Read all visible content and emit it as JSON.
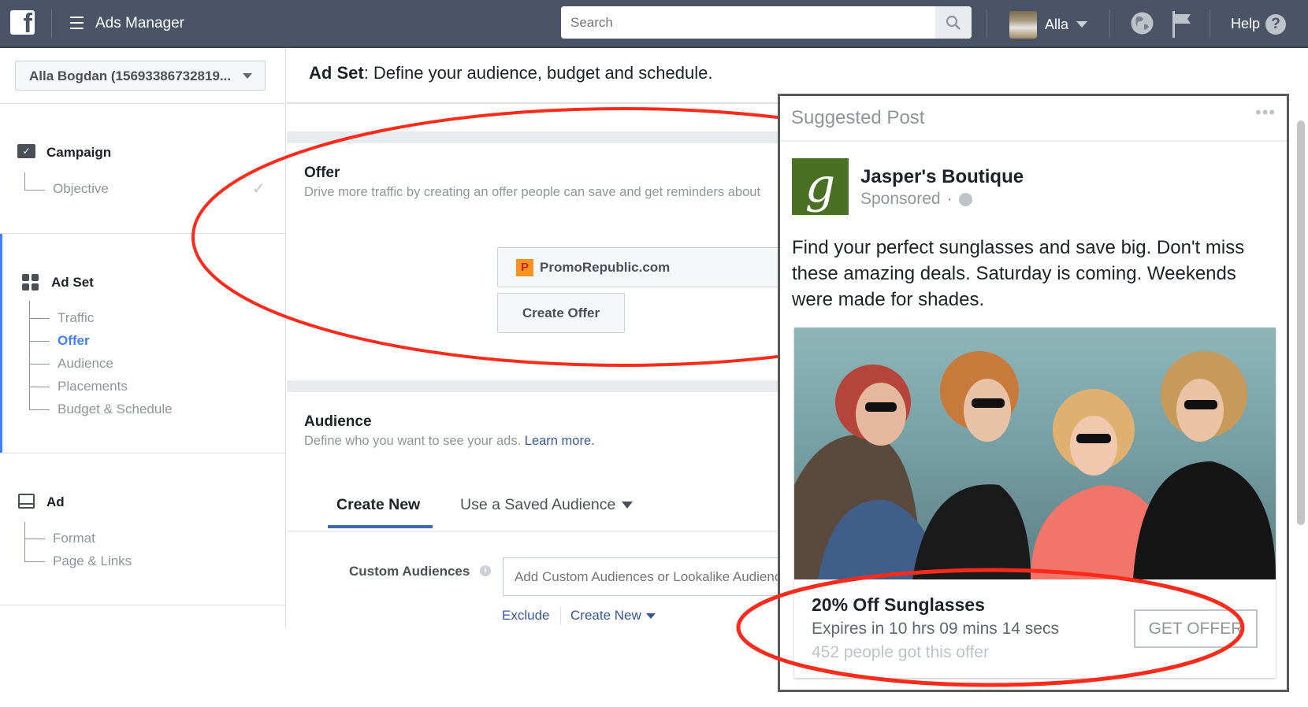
{
  "topbar": {
    "app_title": "Ads Manager",
    "search_placeholder": "Search",
    "user_name": "Alla",
    "help_label": "Help"
  },
  "sidebar": {
    "account": "Alla Bogdan (15693386732819...",
    "sections": [
      {
        "label": "Campaign",
        "items": [
          {
            "label": "Objective",
            "completed": true
          }
        ]
      },
      {
        "label": "Ad Set",
        "items": [
          {
            "label": "Traffic"
          },
          {
            "label": "Offer",
            "active": true
          },
          {
            "label": "Audience"
          },
          {
            "label": "Placements"
          },
          {
            "label": "Budget & Schedule"
          }
        ]
      },
      {
        "label": "Ad",
        "items": [
          {
            "label": "Format"
          },
          {
            "label": "Page & Links"
          }
        ]
      }
    ]
  },
  "main": {
    "header_bold": "Ad Set",
    "header_rest": ": Define your audience, budget and schedule.",
    "offer": {
      "title": "Offer",
      "description": "Drive more traffic by creating an offer people can save and get reminders about",
      "page_name": "PromoRepublic.com",
      "create_button": "Create Offer"
    },
    "audience": {
      "title": "Audience",
      "description": "Define who you want to see your ads.",
      "learn_more": "Learn more.",
      "tabs": [
        {
          "label": "Create New",
          "active": true
        },
        {
          "label": "Use a Saved Audience"
        }
      ],
      "custom_label": "Custom Audiences",
      "custom_placeholder": "Add Custom Audiences or Lookalike Audiences",
      "exclude": "Exclude",
      "create_new": "Create New"
    }
  },
  "preview": {
    "header": "Suggested Post",
    "page_name": "Jasper's Boutique",
    "sponsored": "Sponsored",
    "dot": "·",
    "text": "Find your perfect sunglasses and save big.  Don't miss these amazing deals. Saturday is coming. Weekends were made for shades.",
    "offer_title": "20% Off Sunglasses",
    "expires": "Expires in 10 hrs 09 mins 14 secs",
    "claimed": "452 people got this offer",
    "cta": "GET OFFER"
  },
  "colors": {
    "topbar": "#4b5466",
    "accent": "#4080ff",
    "link": "#365899",
    "annotation": "#ff2a1a",
    "logo_green": "#4a7023"
  }
}
